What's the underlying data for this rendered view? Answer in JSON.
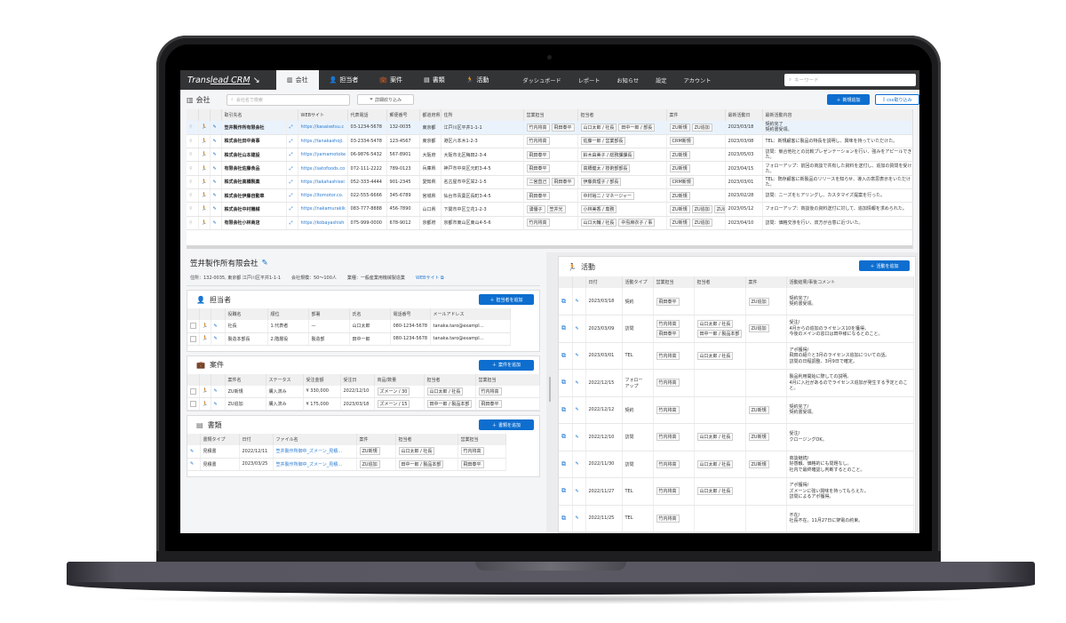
{
  "app": {
    "brand_pre": "Trans",
    "brand_u": "lead CRM",
    "brand_tail": " ↘",
    "tabs": [
      {
        "icon": "building-icon",
        "glyph": "▥",
        "label": "会社",
        "active": true
      },
      {
        "icon": "person-icon",
        "glyph": "👤",
        "label": "担当者"
      },
      {
        "icon": "briefcase-icon",
        "glyph": "💼",
        "label": "案件"
      },
      {
        "icon": "document-icon",
        "glyph": "▤",
        "label": "書類"
      },
      {
        "icon": "running-icon",
        "glyph": "🏃",
        "label": "活動"
      }
    ],
    "links": [
      "ダッシュボード",
      "レポート",
      "お知らせ",
      "設定",
      "アカウント"
    ],
    "search_placeholder": "キーワード"
  },
  "page": {
    "title": "会社",
    "search_placeholder": "会社名で検索",
    "filter_label": "詳細絞り込み",
    "new_label": "新規追加",
    "csv_label": "csv取り込み"
  },
  "company_table": {
    "headers": [
      "取引先名",
      "WEBサイト",
      "代表電話",
      "郵便番号",
      "都道府県",
      "住所",
      "営業担当",
      "担当者",
      "案件",
      "最新活動日",
      "最新活動内容"
    ],
    "rows": [
      {
        "name": "笠井製作所有限会社",
        "web": "https://kasaisetsu.c",
        "tel": "03-1234-5678",
        "zip": "132-0035",
        "pref": "東京都",
        "addr": "江戸川区平井1-1-1",
        "sales": [
          "竹内将高",
          "飛田泰平"
        ],
        "contacts": [
          "山口太郎 / 社長",
          "田中一郎 / 部長"
        ],
        "deals": [
          "ZU新規",
          "ZU追加"
        ],
        "date": "2023/03/18",
        "memo": "契約完了\n契約書受領。",
        "selected": true
      },
      {
        "name": "株式会社田中商事",
        "web": "https://tanakashoji.",
        "tel": "03-2334-5478",
        "zip": "123-4567",
        "pref": "東京都",
        "addr": "港区六本木1-2-3",
        "sales": [
          "竹内将高"
        ],
        "contacts": [
          "佐藤一郎 / 営業部長"
        ],
        "deals": [
          "CRM新規"
        ],
        "date": "2023/03/08",
        "memo": "TEL：新規顧客に製品の特長を説明し、興味を持っていただけた。"
      },
      {
        "name": "株式会社山本建設",
        "web": "https://yamamotoke",
        "tel": "06-9876-5432",
        "zip": "567-8901",
        "pref": "大阪府",
        "addr": "大阪市北区梅田2-3-4",
        "sales": [
          "飛田泰平"
        ],
        "contacts": [
          "鈴木由美子 / 総務課課長"
        ],
        "deals": [
          "ZU新規"
        ],
        "date": "2023/05/03",
        "memo": "訪問：競合他社との比較プレゼンテーションを行い、強みをアピールできた。"
      },
      {
        "name": "有限会社佐藤食品",
        "web": "https://satofoods.co",
        "tel": "072-111-2222",
        "zip": "789-0123",
        "pref": "兵庫県",
        "addr": "神戸市中央区元町3-4-5",
        "sales": [
          "飛田泰平"
        ],
        "contacts": [
          "高橋健太 / 技術部部長"
        ],
        "deals": [
          "ZU新規"
        ],
        "date": "2023/04/15",
        "memo": "フォローアップ：前回の商談で共有した資料を送付し、追加の質問を受けた。"
      },
      {
        "name": "株式会社高橋製薬",
        "web": "https://takahashisei",
        "tel": "052-333-4444",
        "zip": "901-2345",
        "pref": "愛知県",
        "addr": "名古屋市中区栄2-1-5",
        "sales": [
          "二宮直己",
          "飛田泰平"
        ],
        "contacts": [
          "伊藤真理子 / 部長"
        ],
        "deals": [
          "CRM新規"
        ],
        "date": "2023/03/01",
        "memo": "TEL：既存顧客に新製品のリリースを知らせ、導入の意思表示をいただけた。"
      },
      {
        "name": "株式会社伊藤自動車",
        "web": "https://itomotor.co.",
        "tel": "022-555-6666",
        "zip": "345-6789",
        "pref": "宮城県",
        "addr": "仙台市青葉区長町3-4-5",
        "sales": [
          "飛田泰平"
        ],
        "contacts": [
          "中村裕二 / マネージャー"
        ],
        "deals": [
          "ZU新規"
        ],
        "date": "2023/02/28",
        "memo": "訪問：ニーズをヒアリングし、カスタマイズ提案を行った。"
      },
      {
        "name": "株式会社中村機械",
        "web": "https://nakamurakik",
        "tel": "083-777-8888",
        "zip": "456-7890",
        "pref": "山口県",
        "addr": "下関市中区立花1-2-3",
        "sales": [
          "湧優子",
          "笠井光"
        ],
        "contacts": [
          "小林美香 / 専務"
        ],
        "deals": [
          "ZU新規",
          "ZU追加",
          "ZU追"
        ],
        "date": "2023/05/12",
        "memo": "フォローアップ：商談後の資料送付に対して、追加情報を求められた。"
      },
      {
        "name": "有限会社小林商店",
        "web": "https://kobayashish",
        "tel": "075-999-0000",
        "zip": "678-9012",
        "pref": "京都府",
        "addr": "京都市東山区東山4-5-6",
        "sales": [
          "竹内将高"
        ],
        "contacts": [
          "山口大輔 / 社長",
          "中島麻衣子 / 事"
        ],
        "deals": [
          "ZU新規",
          "ZU追加"
        ],
        "date": "2023/04/10",
        "memo": "訪問：価格交渉を行い、双方が合意に近づいた。"
      }
    ]
  },
  "detail": {
    "company_name": "笠井製作所有限会社",
    "address": "住所：132-0035, 東京都 江戸川区平井1-1-1",
    "size": "会社規模：50～100人",
    "industry": "業種：一般産業用機械製造業",
    "web_link": "WEBサイト ⧉"
  },
  "contacts": {
    "title": "担当者",
    "add_label": "担当者を追加",
    "headers": [
      "役職名",
      "順位",
      "部署",
      "氏名",
      "電話番号",
      "メールアドレス"
    ],
    "rows": [
      [
        "社長",
        "1.代表者",
        "—",
        "山口太郎",
        "080-1234-5678",
        "tanaka.taro@exampl…"
      ],
      [
        "製造本部長",
        "2.階層役",
        "製造部",
        "田中一郎",
        "080-1234-5678",
        "tanaka.taro@exampl…"
      ]
    ]
  },
  "deals": {
    "title": "案件",
    "add_label": "案件を追加",
    "headers": [
      "案件名",
      "ステータス",
      "受注金額",
      "受注日",
      "商品/数量",
      "担当者",
      "営業担当"
    ],
    "rows": [
      [
        "ZU新規",
        "購入済み",
        "¥ 330,000",
        "2022/12/10",
        "ズメーン / 30",
        "山口太郎 / 社長",
        "竹内将高"
      ],
      [
        "ZU追加",
        "購入済み",
        "¥ 175,000",
        "2023/03/18",
        "ズメーン / 15",
        "田中一郎 / 製品本部",
        "飛田泰平"
      ]
    ]
  },
  "documents": {
    "title": "書類",
    "add_label": "書類を追加",
    "headers": [
      "書類タイプ",
      "日付",
      "ファイル名",
      "案件",
      "担当者",
      "営業担当"
    ],
    "rows": [
      [
        "見積書",
        "2022/12/11",
        "笠井製作所御中_ズメーン_見積…",
        "ZU新規",
        "山口太郎 / 社長",
        "竹内将高"
      ],
      [
        "見積書",
        "2023/03/25",
        "笠井製作所御中_ズメーン_見積…",
        "ZU追加",
        "田中一郎 / 製品本部",
        "飛田泰平"
      ]
    ]
  },
  "activities": {
    "title": "活動",
    "add_label": "活動を追加",
    "headers": [
      "日付",
      "活動タイプ",
      "営業担当",
      "担当者",
      "案件",
      "活動結果/事後コメント"
    ],
    "rows": [
      {
        "date": "2023/03/18",
        "type": "契約",
        "sales": [
          "飛田泰平"
        ],
        "contacts": [],
        "deal": "ZU追加",
        "comment": "契約完了/\n契約書受領。"
      },
      {
        "date": "2023/03/09",
        "type": "訪問",
        "sales": [
          "竹内将高",
          "飛田泰平"
        ],
        "contacts": [
          "山口太郎 / 社長",
          "田中一郎 / 製品本部"
        ],
        "deal": "ZU追加",
        "comment": "受注/\n4月からの追加のライセンス10を獲得。\n今後のメインの窓口は田中様になるとのこと。"
      },
      {
        "date": "2023/03/01",
        "type": "TEL",
        "sales": [
          "竹内将高"
        ],
        "contacts": [
          "山口太郎 / 社長"
        ],
        "deal": "",
        "comment": "アポ獲得/\n飛田の紹介と3月のライセンス追加についての話。\n訪問の日程調整、3月9日で確定。"
      },
      {
        "date": "2022/12/15",
        "type": "フォロー\nアップ",
        "sales": [
          "竹内将高"
        ],
        "contacts": [],
        "deal": "",
        "comment": "製品利用開始に際しての説明。\n4月に入社があるのでライセンス追加が発生する予定とのこと。"
      },
      {
        "date": "2022/12/12",
        "type": "契約",
        "sales": [
          "竹内将高"
        ],
        "contacts": [],
        "deal": "ZU新規",
        "comment": "契約完了/\n契約書受領。"
      },
      {
        "date": "2022/12/10",
        "type": "訪問",
        "sales": [
          "竹内将高"
        ],
        "contacts": [
          "山口太郎 / 社長"
        ],
        "deal": "ZU新規",
        "comment": "受注/\nクロージングOK。"
      },
      {
        "date": "2022/11/30",
        "type": "訪問",
        "sales": [
          "竹内将高"
        ],
        "contacts": [
          "山口太郎 / 社長"
        ],
        "deal": "ZU新規",
        "comment": "商談継続/\n好感触、価格的にも問題なし。\n社内で最終確認し判断するとのこと。"
      },
      {
        "date": "2022/11/27",
        "type": "TEL",
        "sales": [
          "竹内将高"
        ],
        "contacts": [
          "山口太郎 / 社長"
        ],
        "deal": "",
        "comment": "アポ獲得/\nズメーンに強い興味を持ってもらえた。\n訪問によるアポ獲得。"
      },
      {
        "date": "2022/11/25",
        "type": "TEL",
        "sales": [
          "竹内将高"
        ],
        "contacts": [],
        "deal": "",
        "comment": "不在/\n社長不在。11月27日に架電の約束。"
      }
    ]
  },
  "colors": {
    "accent": "#0d6ecf",
    "nav_bg": "#333436",
    "link": "#2a7bd1",
    "selected_row": "#eaf3fc"
  }
}
